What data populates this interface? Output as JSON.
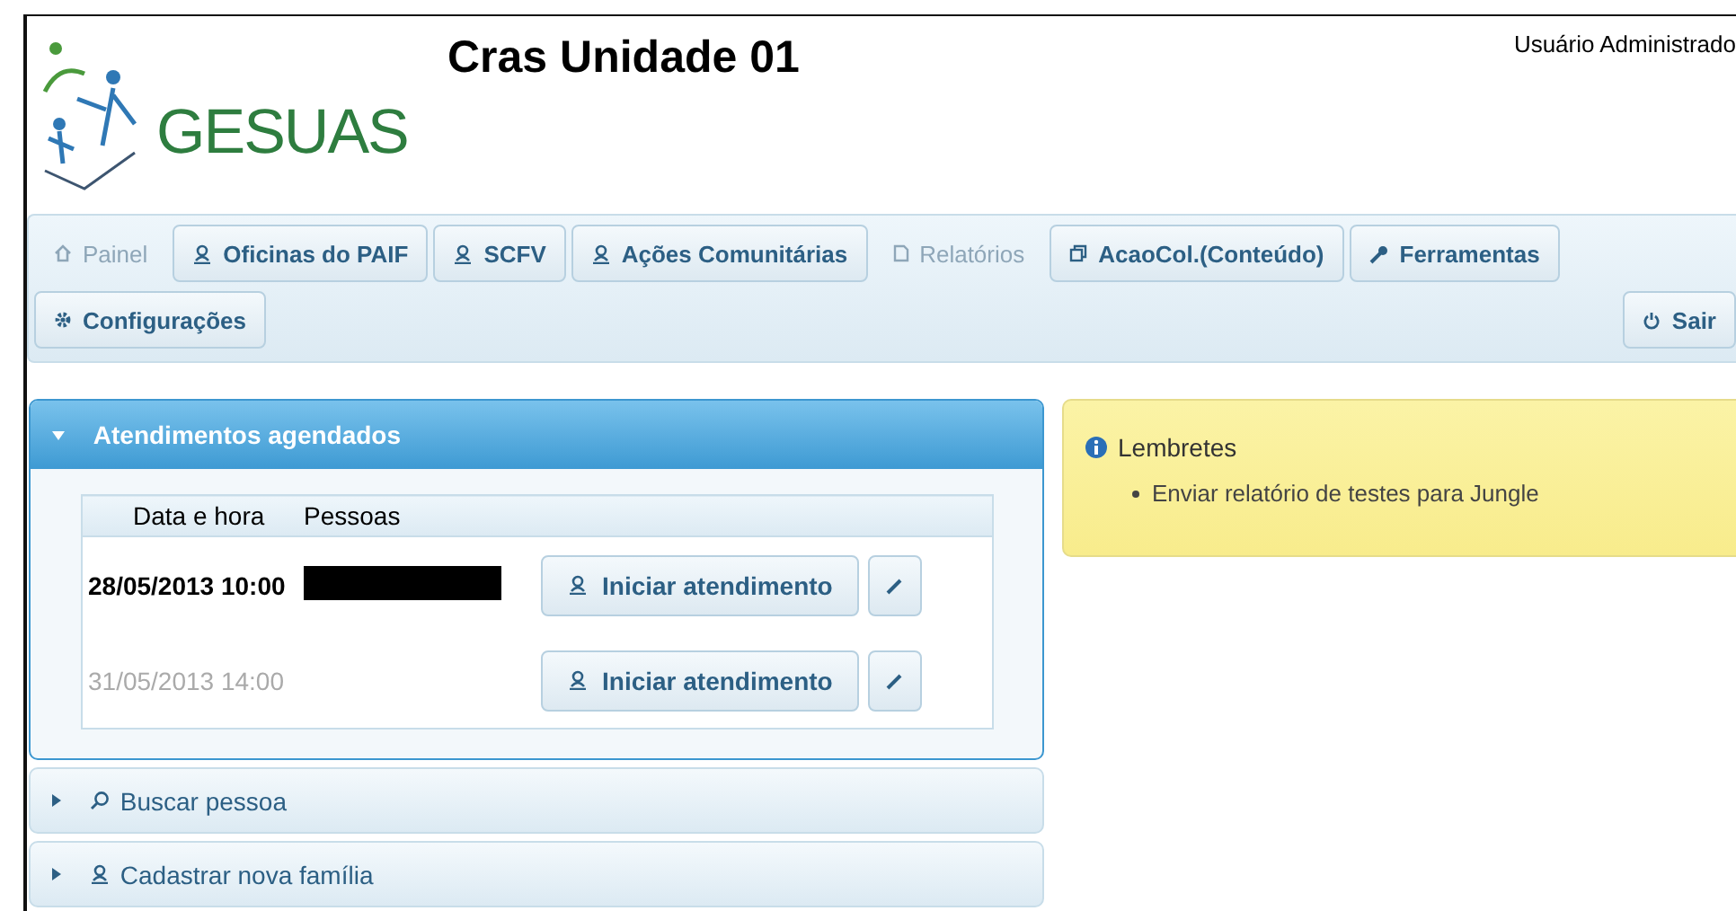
{
  "header": {
    "logo_text": "GESUAS",
    "title": "Cras Unidade 01",
    "user": "Usuário Administrado"
  },
  "menu": [
    {
      "label": "Painel",
      "disabled": true
    },
    {
      "label": "Oficinas do PAIF",
      "disabled": false
    },
    {
      "label": "SCFV",
      "disabled": false
    },
    {
      "label": "Ações Comunitárias",
      "disabled": false
    },
    {
      "label": "Relatórios",
      "disabled": true
    },
    {
      "label": "AcaoCol.(Conteúdo)",
      "disabled": false
    },
    {
      "label": "Ferramentas",
      "disabled": false
    },
    {
      "label": "Configurações",
      "disabled": false
    }
  ],
  "logout": {
    "label": "Sair"
  },
  "panels": [
    {
      "title": "Atendimentos agendados",
      "expanded": true
    },
    {
      "title": "Buscar pessoa",
      "expanded": false
    },
    {
      "title": "Cadastrar nova família",
      "expanded": false
    }
  ],
  "appointments": {
    "columns": [
      "Data e hora",
      "Pessoas"
    ],
    "rows": [
      {
        "datetime": "28/05/2013 10:00",
        "muted": false,
        "action": "Iniciar atendimento"
      },
      {
        "datetime": "31/05/2013 14:00",
        "muted": true,
        "action": "Iniciar atendimento"
      }
    ]
  },
  "reminders": {
    "title": "Lembretes",
    "items": [
      "Enviar relatório de testes para Jungle"
    ]
  }
}
